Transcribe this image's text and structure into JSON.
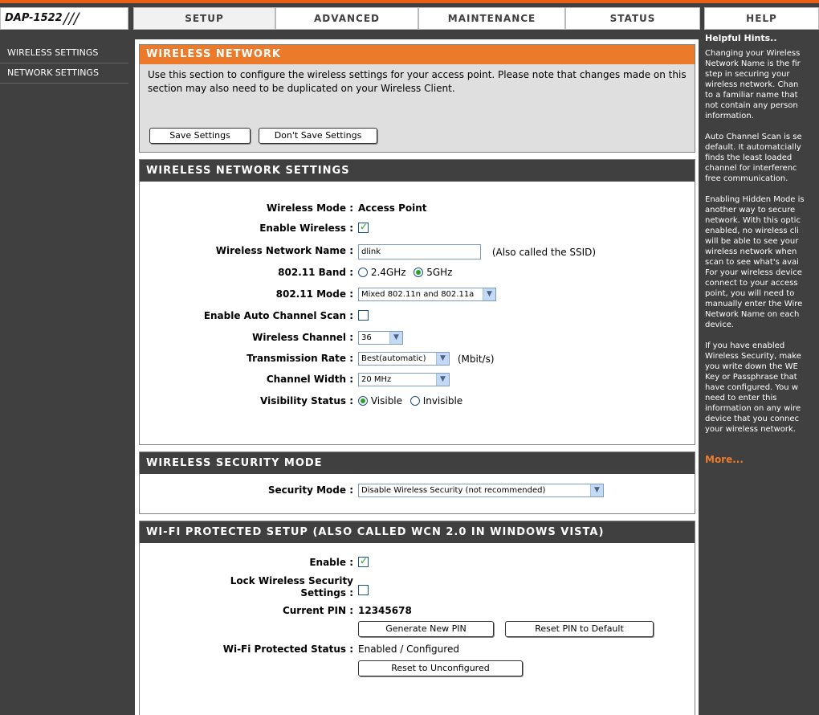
{
  "header": {
    "logo": "DAP-1522",
    "tabs": [
      "SETUP",
      "ADVANCED",
      "MAINTENANCE",
      "STATUS",
      "HELP"
    ],
    "active_tab": "SETUP"
  },
  "leftnav": {
    "items": [
      "WIRELESS SETTINGS",
      "NETWORK SETTINGS"
    ]
  },
  "intro": {
    "title": "WIRELESS NETWORK",
    "text": "Use this section to configure the wireless settings for your access point. Please note that changes made on this section may also need to be duplicated on your Wireless Client.",
    "save_label": "Save Settings",
    "dont_save_label": "Don't Save Settings"
  },
  "wireless": {
    "title": "WIRELESS NETWORK SETTINGS",
    "mode_label": "Wireless Mode :",
    "mode_value": "Access Point",
    "enable_label": "Enable Wireless :",
    "enable_checked": true,
    "ssid_label": "Wireless Network Name :",
    "ssid_value": "dlink",
    "ssid_note": "(Also called the SSID)",
    "band_label": "802.11 Band :",
    "band_options": [
      "2.4GHz",
      "5GHz"
    ],
    "band_selected": "5GHz",
    "mode80211_label": "802.11 Mode :",
    "mode80211_value": "Mixed 802.11n and 802.11a",
    "autoscan_label": "Enable Auto Channel Scan :",
    "autoscan_checked": false,
    "channel_label": "Wireless Channel :",
    "channel_value": "36",
    "rate_label": "Transmission Rate :",
    "rate_value": "Best(automatic)",
    "rate_unit": "(Mbit/s)",
    "width_label": "Channel Width :",
    "width_value": "20 MHz",
    "visibility_label": "Visibility Status :",
    "visibility_options": [
      "Visible",
      "Invisible"
    ],
    "visibility_selected": "Visible"
  },
  "security": {
    "title": "WIRELESS SECURITY MODE",
    "mode_label": "Security Mode :",
    "mode_value": "Disable Wireless Security (not recommended)"
  },
  "wps": {
    "title": "WI-FI PROTECTED SETUP (ALSO CALLED WCN 2.0 IN WINDOWS VISTA)",
    "enable_label": "Enable :",
    "enable_checked": true,
    "lock_label_1": "Lock Wireless Security",
    "lock_label_2": "Settings :",
    "lock_checked": false,
    "pin_label": "Current PIN :",
    "pin_value": "12345678",
    "gen_pin_label": "Generate New PIN",
    "reset_pin_label": "Reset PIN to Default",
    "status_label": "Wi-Fi Protected Status :",
    "status_value": "Enabled / Configured",
    "reset_unconf_label": "Reset to Unconfigured"
  },
  "help": {
    "title": "Helpful Hints..",
    "p1": "Changing your Wireless\nNetwork Name is the fir\nstep in securing your\nwireless network. Chan\nto a familiar name that\nnot contain any person\ninformation.",
    "p2": "Auto Channel Scan is se\ndefault. It automatcially\nfinds the least loaded\nchannel for interferenc\nfree communication.",
    "p3": "Enabling Hidden Mode is\nanother way to secure\nnetwork. With this optic\nenabled, no wireless cli\nwill be able to see your\nwireless network when\nscan to see what's avai\nFor your wireless device\nconnect to your access\npoint, you will need to\nmanually enter the Wire\nNetwork Name on each\ndevice.",
    "p4": "If you have enabled\nWireless Security, make\nyou write down the WE\nKey or Passphrase that\nhave configured. You w\nneed to enter this\ninformation on any wire\ndevice that you connec\nyour wireless network.",
    "more": "More..."
  },
  "colors": {
    "accent": "#EC7A2B",
    "dark": "#404040"
  }
}
